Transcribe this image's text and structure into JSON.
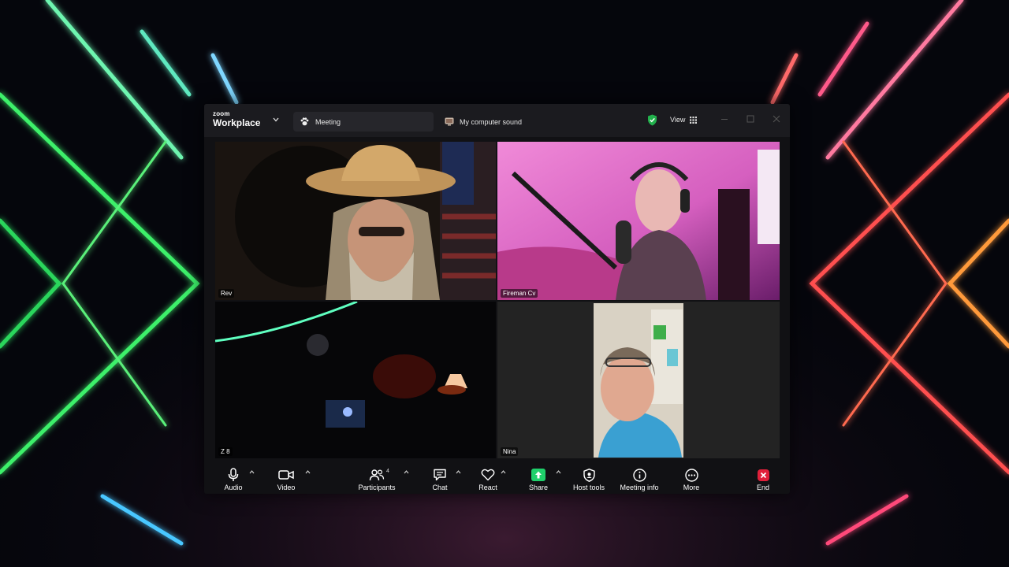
{
  "app": {
    "brand_small": "zoom",
    "brand_name": "Workplace"
  },
  "tabs": {
    "meeting": "Meeting",
    "sound": "My computer sound"
  },
  "header": {
    "view_label": "View"
  },
  "participants": [
    {
      "name": "Rev"
    },
    {
      "name": "Fireman Cv"
    },
    {
      "name": "Z 8"
    },
    {
      "name": "Nina",
      "active_speaker": true
    }
  ],
  "toolbar": {
    "audio": "Audio",
    "video": "Video",
    "participants": "Participants",
    "participant_count": "4",
    "chat": "Chat",
    "react": "React",
    "share": "Share",
    "host_tools": "Host tools",
    "meeting_info": "Meeting info",
    "more": "More",
    "end": "End"
  },
  "colors": {
    "share_green": "#1fd06b",
    "active_outline": "#2ecc71",
    "end_red": "#e0203a",
    "shield_green": "#22b14c"
  }
}
